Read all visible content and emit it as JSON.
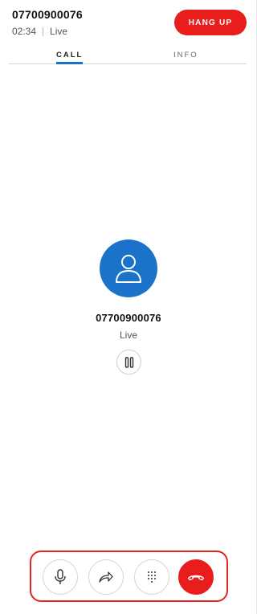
{
  "header": {
    "caller_number": "07700900076",
    "duration": "02:34",
    "status": "Live",
    "hangup_label": "HANG UP"
  },
  "tabs": [
    {
      "label": "CALL",
      "active": true
    },
    {
      "label": "INFO",
      "active": false
    }
  ],
  "profile": {
    "number": "07700900076",
    "status": "Live"
  },
  "icons": {
    "avatar": "person-icon",
    "hold": "pause-icon",
    "mute": "microphone-icon",
    "transfer": "forward-arrow-icon",
    "keypad": "dialpad-icon",
    "end": "phone-hangup-icon"
  },
  "colors": {
    "accent_blue": "#1a73c9",
    "hangup_red": "#ea1d1d",
    "highlight_outline": "#e0261f"
  }
}
